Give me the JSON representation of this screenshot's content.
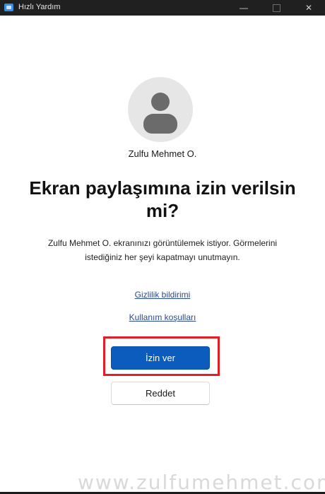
{
  "window": {
    "title": "Hızlı Yardım",
    "controls": [
      "—",
      "☐",
      "✕"
    ]
  },
  "user": {
    "name": "Zulfu Mehmet O."
  },
  "prompt": {
    "heading": "Ekran paylaşımına izin verilsin mi?",
    "description": "Zulfu Mehmet O. ekranınızı görüntülemek istiyor. Görmelerini istediğiniz her şeyi kapatmayı unutmayın."
  },
  "links": {
    "privacy": "Gizlilik bildirimi",
    "terms": "Kullanım koşulları"
  },
  "buttons": {
    "allow": "İzin ver",
    "deny": "Reddet"
  },
  "watermark": "www.zulfumehmet.com",
  "colors": {
    "primary": "#0b5cbc",
    "highlight": "#e41e25",
    "link": "#2a4a94"
  }
}
